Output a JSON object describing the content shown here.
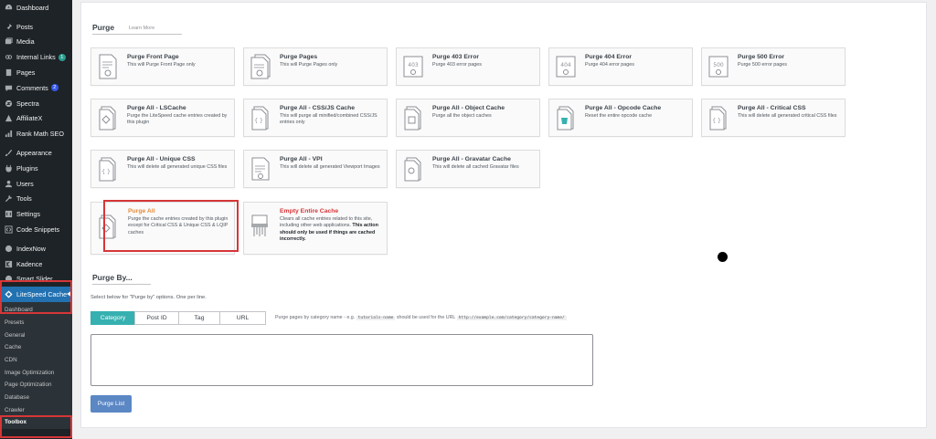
{
  "sidebar": {
    "items": [
      {
        "label": "Dashboard",
        "icon": "dashboard-icon"
      },
      {
        "label": "Posts",
        "icon": "pin-icon"
      },
      {
        "label": "Media",
        "icon": "media-icon"
      },
      {
        "label": "Internal Links",
        "icon": "link-icon",
        "badge": "1"
      },
      {
        "label": "Pages",
        "icon": "page-icon"
      },
      {
        "label": "Comments",
        "icon": "comment-icon",
        "badge": "2"
      },
      {
        "label": "Spectra",
        "icon": "spectra-icon"
      },
      {
        "label": "AffiliateX",
        "icon": "affiliatex-icon"
      },
      {
        "label": "Rank Math SEO",
        "icon": "chart-icon"
      },
      {
        "label": "Appearance",
        "icon": "brush-icon"
      },
      {
        "label": "Plugins",
        "icon": "plugin-icon"
      },
      {
        "label": "Users",
        "icon": "user-icon"
      },
      {
        "label": "Tools",
        "icon": "wrench-icon"
      },
      {
        "label": "Settings",
        "icon": "settings-icon"
      },
      {
        "label": "Code Snippets",
        "icon": "code-icon"
      },
      {
        "label": "IndexNow",
        "icon": "indexnow-icon"
      },
      {
        "label": "Kadence",
        "icon": "kadence-icon"
      },
      {
        "label": "Smart Slider",
        "icon": "slider-icon"
      },
      {
        "label": "LiteSpeed Cache",
        "icon": "litespeed-icon"
      }
    ],
    "submenu": [
      "Dashboard",
      "Presets",
      "General",
      "Cache",
      "CDN",
      "Image Optimization",
      "Page Optimization",
      "Database",
      "Crawler",
      "Toolbox"
    ]
  },
  "purge": {
    "title": "Purge",
    "learn_more": "Learn More",
    "cards": [
      {
        "title": "Purge Front Page",
        "desc": "This will Purge Front Page only"
      },
      {
        "title": "Purge Pages",
        "desc": "This will Purge Pages only"
      },
      {
        "title": "Purge 403 Error",
        "desc": "Purge 403 error pages",
        "code": "403"
      },
      {
        "title": "Purge 404 Error",
        "desc": "Purge 404 error pages",
        "code": "404"
      },
      {
        "title": "Purge 500 Error",
        "desc": "Purge 500 error pages",
        "code": "500"
      },
      {
        "title": "Purge All - LSCache",
        "desc": "Purge the LiteSpeed cache entries created by this plugin"
      },
      {
        "title": "Purge All - CSS/JS Cache",
        "desc": "This will purge all minified/combined CSS/JS entries only"
      },
      {
        "title": "Purge All - Object Cache",
        "desc": "Purge all the object caches"
      },
      {
        "title": "Purge All - Opcode Cache",
        "desc": "Reset the entire opcode cache"
      },
      {
        "title": "Purge All - Critical CSS",
        "desc": "This will delete all generated critical CSS files"
      },
      {
        "title": "Purge All - Unique CSS",
        "desc": "This will delete all generated unique CSS files"
      },
      {
        "title": "Purge All - VPI",
        "desc": "This will delete all generated Viewport Images"
      },
      {
        "title": "Purge All - Gravatar Cache",
        "desc": "This will delete all cached Gravatar files"
      },
      {
        "title": "Purge All",
        "desc": "Purge the cache entries created by this plugin except for Critical CSS & Unique CSS & LQIP caches"
      },
      {
        "title": "Empty Entire Cache",
        "desc": "Clears all cache entries related to this site, including other web applications.",
        "desc_bold": "This action should only be used if things are cached incorrectly."
      }
    ]
  },
  "purge_by": {
    "title": "Purge By...",
    "instructions": "Select below for \"Purge by\" options. One per line.",
    "tabs": [
      "Category",
      "Post ID",
      "Tag",
      "URL"
    ],
    "active_tab": "Category",
    "hint_prefix": "Purge pages by category name - e.g.",
    "hint_code_1": "tutorials-name",
    "hint_middle": "should be used for the URL",
    "hint_code_2": "http://example.com/category/category-name/",
    "textarea_value": "",
    "button": "Purge List"
  },
  "colors": {
    "sidebar_bg": "#1d2327",
    "active_menu": "#2271b1",
    "active_tab": "#36b0b0",
    "button": "#5b87c4",
    "highlight_box": "#d63638",
    "purge_all_title": "#e58b3a",
    "empty_cache_title": "#d63638"
  }
}
